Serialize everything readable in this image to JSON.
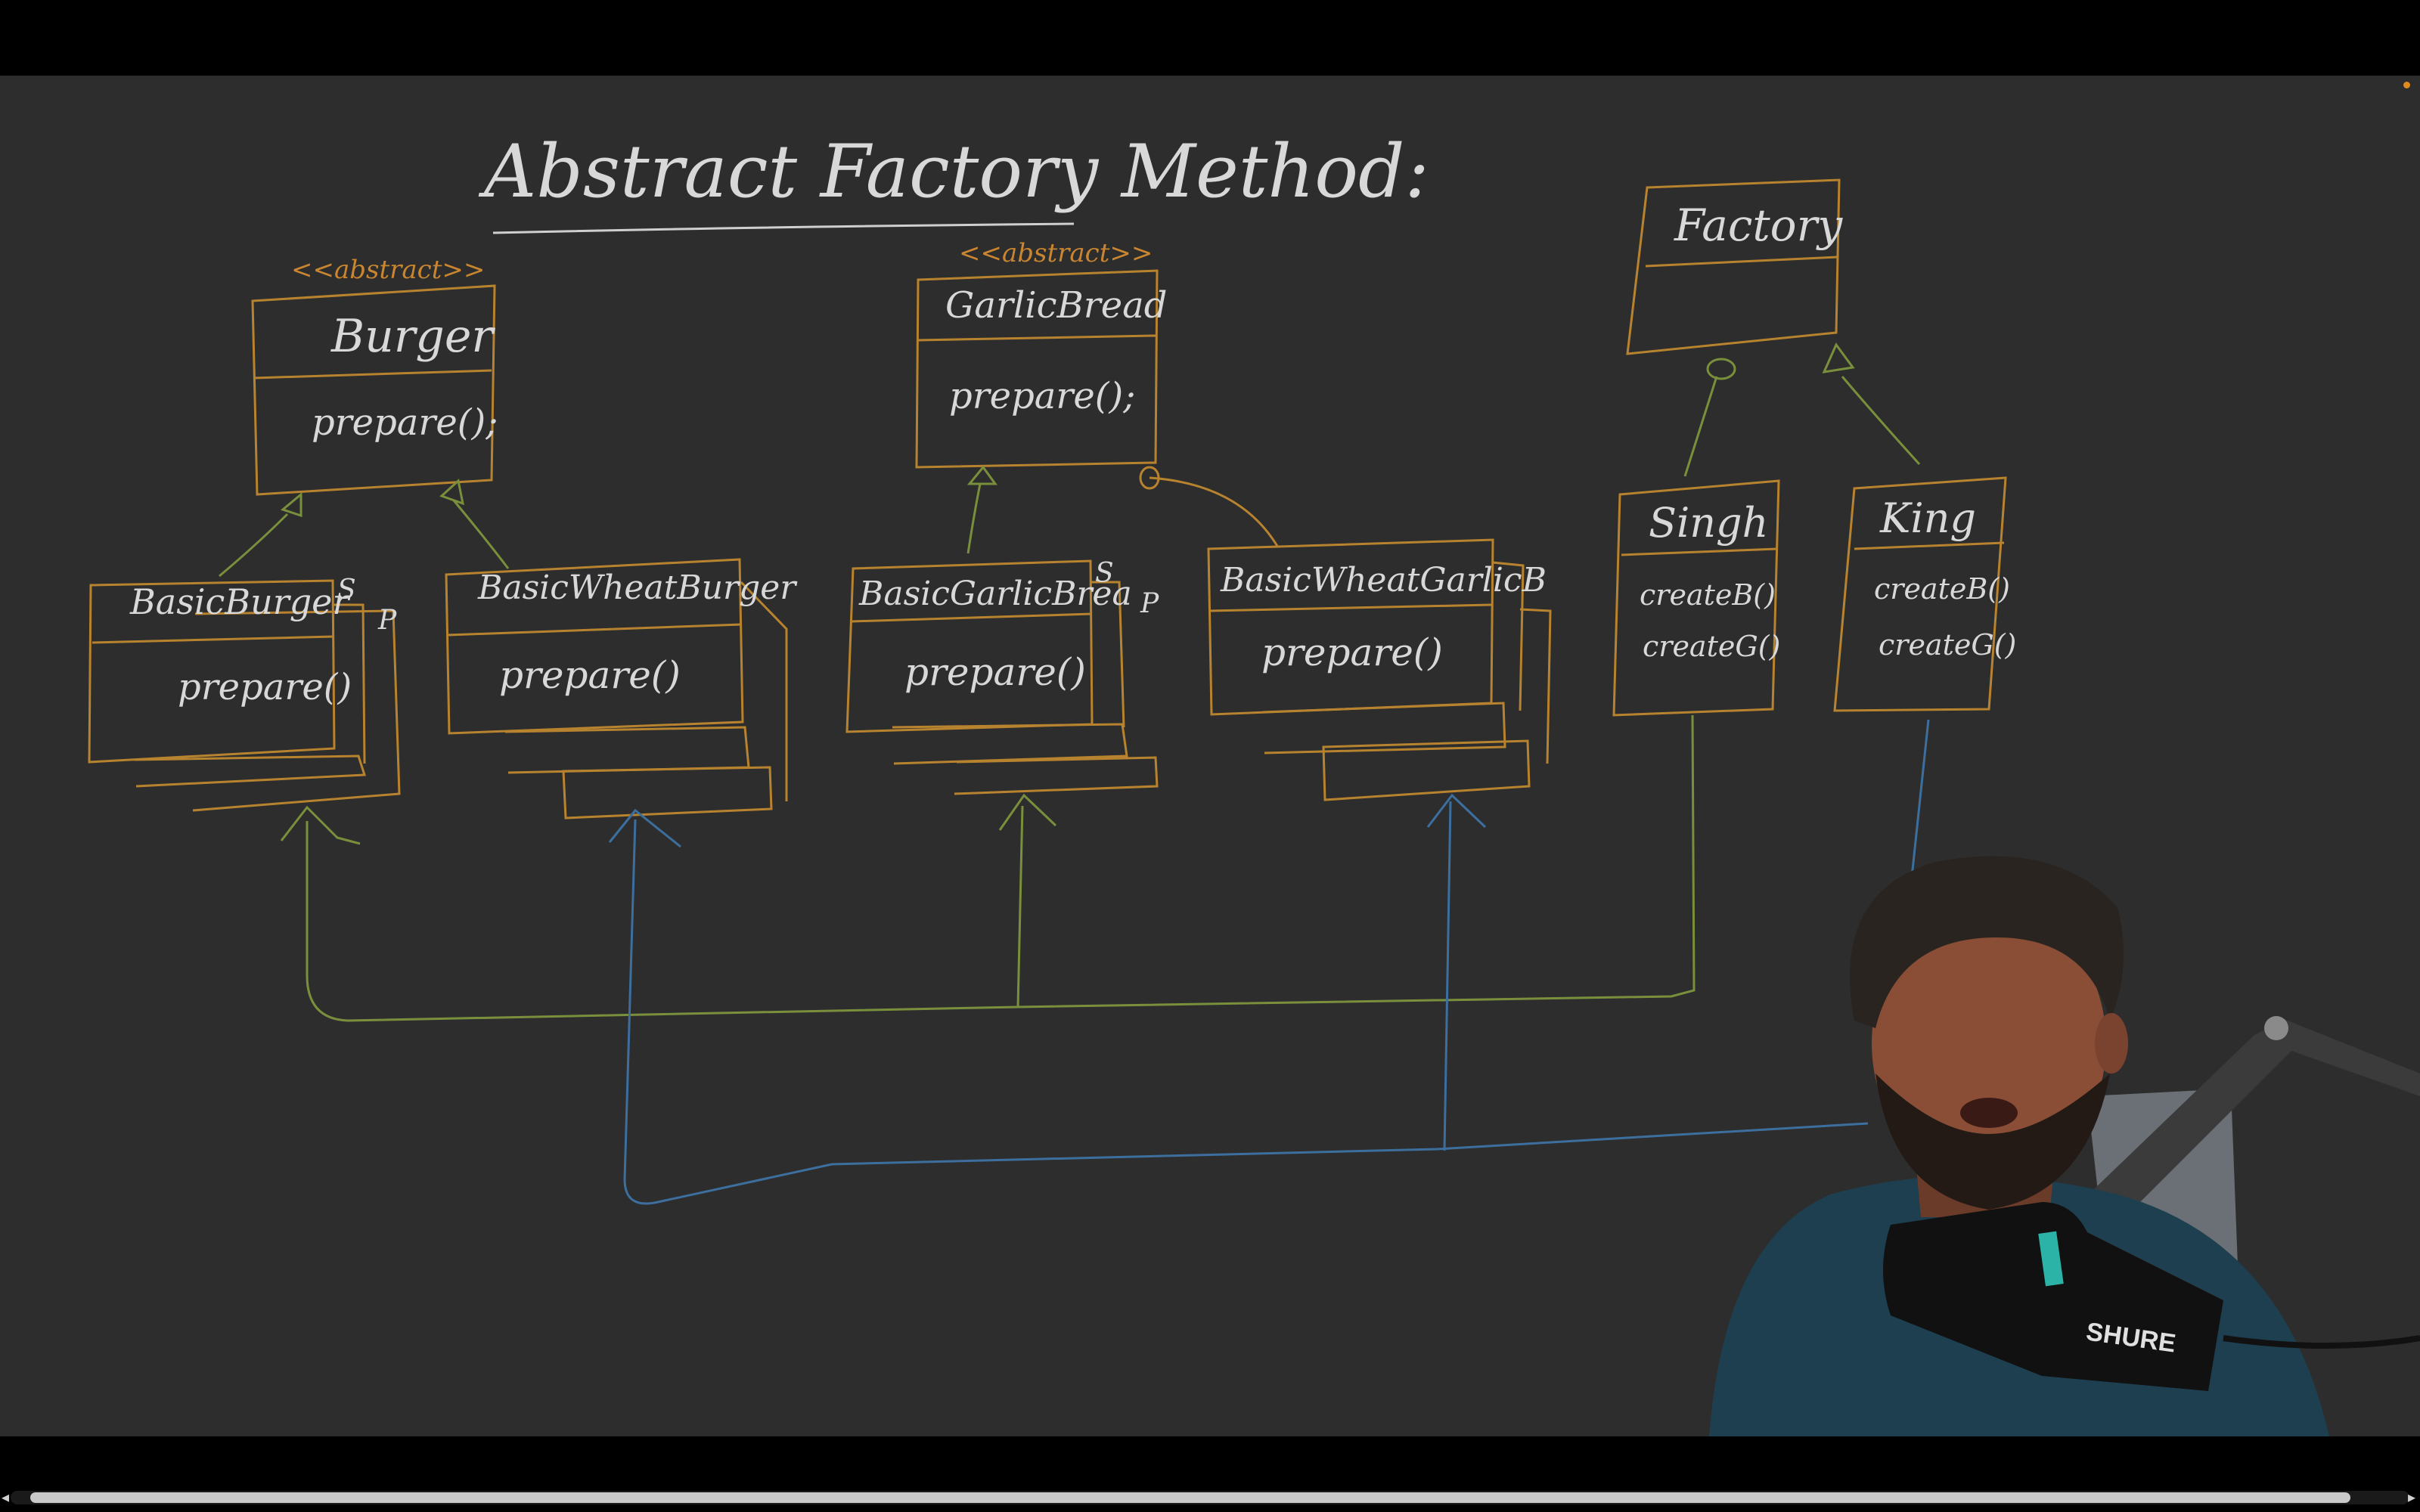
{
  "title": "Abstract Factory Method:",
  "colors": {
    "background": "#2d2d2d",
    "orange_ink": "#b7832f",
    "green_ink": "#7a8f3c",
    "blue_ink": "#3d6f9e",
    "white_ink": "#d8d8d8"
  },
  "classes": {
    "burger": {
      "stereotype": "<<abstract>>",
      "name": "Burger",
      "method": "prepare();"
    },
    "garlic_bread": {
      "stereotype": "<<abstract>>",
      "name": "GarlicBread",
      "method": "prepare();"
    },
    "basic_burger": {
      "name": "BasicBurger",
      "method": "prepare()",
      "tag_s": "S",
      "tag_p": "P"
    },
    "basic_wheat_burger": {
      "name": "BasicWheatBurger",
      "method": "prepare()"
    },
    "basic_garlic_bread": {
      "name": "BasicGarlicBrea",
      "method": "prepare()",
      "tag_s": "S",
      "tag_p": "P"
    },
    "basic_wheat_garlic": {
      "name": "BasicWheatGarlicB",
      "method": "prepare()"
    },
    "factory": {
      "name": "Factory"
    },
    "singh": {
      "name": "Singh",
      "method1": "createB()",
      "method2": "createG()"
    },
    "king": {
      "name": "King",
      "method1": "createB()",
      "method2": "createG()"
    }
  },
  "webcam": {
    "mic_brand": "SHURE",
    "icon": "presenter-webcam"
  },
  "scroll": {
    "left_arrow": "◂",
    "right_arrow": "▸"
  }
}
